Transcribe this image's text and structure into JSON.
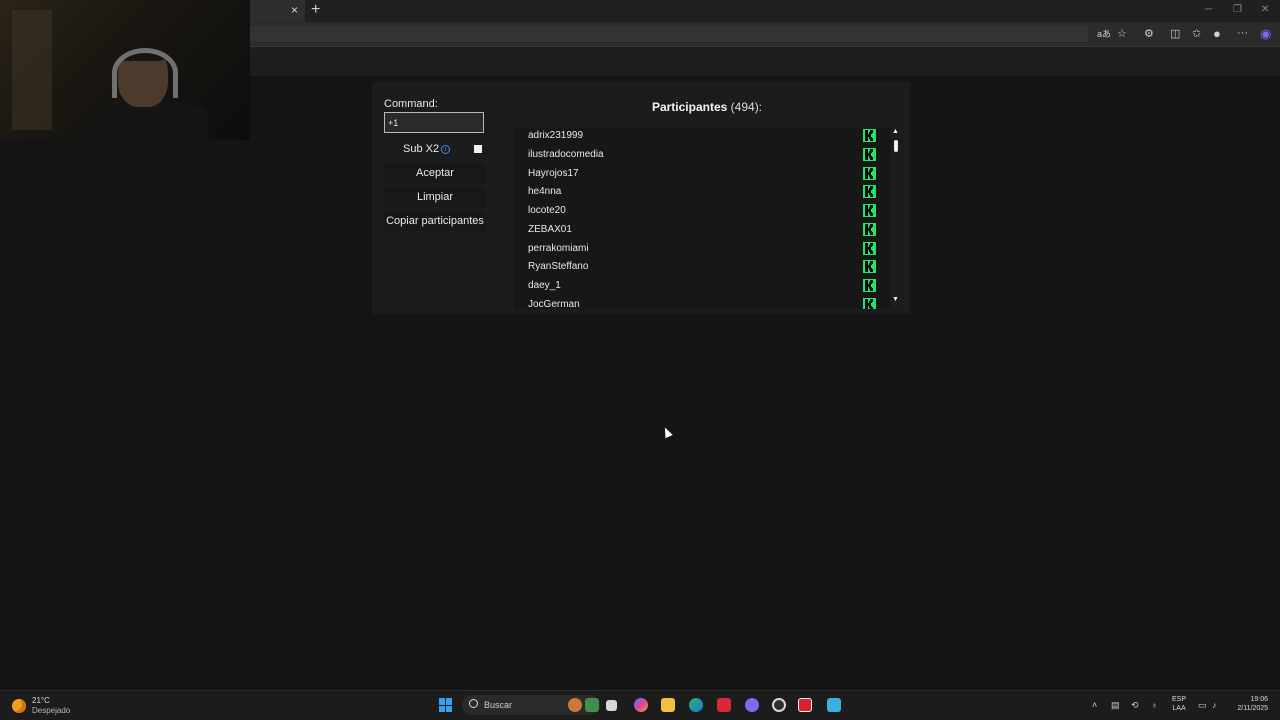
{
  "browser": {
    "tab_close": "×",
    "new_tab": "+",
    "window_controls": [
      "─",
      "❐",
      "✕"
    ],
    "toolbar_icons": [
      "read-aloud-icon",
      "star-icon",
      "extensions-icon",
      "split-screen-icon",
      "favorites-icon",
      "profile-icon",
      "menu-icon",
      "copilot-icon"
    ],
    "toolbar_text": {
      "read_aloud": "aあ",
      "menu": "···"
    }
  },
  "app": {
    "command_label": "Command:",
    "command_value": "+1",
    "sub_label": "Sub X2",
    "info_glyph": "i",
    "sub_checked": false,
    "accept_label": "Aceptar",
    "clear_label": "Limpiar",
    "copy_label": "Copiar participantes",
    "participants_title": "Participantes",
    "participants_count": "(494):",
    "participants": [
      "adrix231999",
      "ilustradocomedia",
      "Hayrojos17",
      "he4nna",
      "locote20",
      "ZEBAX01",
      "perrakomiami",
      "RyanSteffano",
      "daey_1",
      "JocGerman"
    ],
    "platform_icon": "kick-icon",
    "platform_color": "#23e36b",
    "scroll_up": "▲",
    "scroll_down": "▼"
  },
  "taskbar": {
    "weather_temp": "21°C",
    "weather_desc": "Despejado",
    "search_placeholder": "Buscar",
    "lang_top": "ESP",
    "lang_bottom": "LAA",
    "time": "19:06",
    "date": "2/11/2025"
  }
}
